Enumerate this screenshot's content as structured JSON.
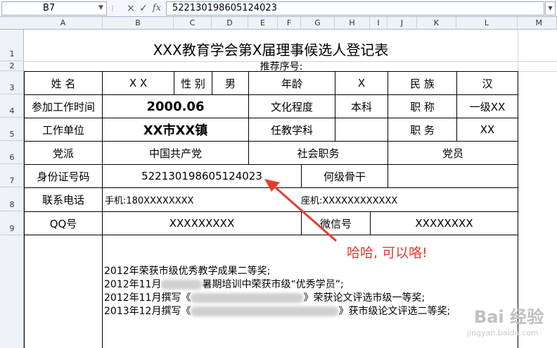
{
  "formula_bar": {
    "name_box": "B7",
    "cancel_icon": "×",
    "enter_icon": "✓",
    "fx_label": "fx",
    "formula_value": "522130198605124023"
  },
  "columns": [
    "A",
    "B",
    "C",
    "D",
    "E",
    "F",
    "G",
    "H",
    "I",
    "J",
    "K",
    "L",
    "M"
  ],
  "rows": [
    "1",
    "2",
    "3",
    "4",
    "5",
    "6",
    "7",
    "8",
    "9"
  ],
  "sheet": {
    "title": "XXX教育学会第X届理事候选人登记表",
    "recommend_no": "推荐序号:",
    "r3": {
      "name_label": "姓    名",
      "name_value": "X X",
      "gender_label": "性 别",
      "gender_value": "男",
      "age_label": "年龄",
      "age_value": "X",
      "ethnic_label": "民    族",
      "ethnic_value": "汉"
    },
    "r4": {
      "work_start_label": "参加工作时间",
      "work_start_value": "2000.06",
      "education_label": "文化程度",
      "education_value": "本科",
      "title_label": "职    称",
      "title_value": "一级XX"
    },
    "r5": {
      "employer_label": "工作单位",
      "employer_value": "XX市XX镇",
      "subject_label": "任教学科",
      "subject_value": "",
      "position_label": "职    务",
      "position_value": "XX"
    },
    "r6": {
      "party_label": "党派",
      "party_value": "中国共产党",
      "social_label": "社会职务",
      "social_value": "党员"
    },
    "r7": {
      "id_label": "身份证号码",
      "id_value": "522130198605124023",
      "backbone_label": "何级骨干",
      "backbone_value": ""
    },
    "r8": {
      "phone_label": "联系电话",
      "mobile": "手机:180XXXXXXXX",
      "landline": "座机:XXXXXXXXXXXX"
    },
    "r9": {
      "qq_label": "QQ号",
      "qq_value": "XXXXXXXXX",
      "wechat_label": "微信号",
      "wechat_value": "XXXXXXXX"
    },
    "awards": [
      {
        "before": "2012年荣获市级优秀教学成果二等奖;",
        "after": ""
      },
      {
        "before": "2012年11月",
        "after": "暑期培训中荣获市级“优秀学员”;"
      },
      {
        "before": "2012年11月撰写《",
        "after": "》荣获论文评选市级一等奖;"
      },
      {
        "before": "2013年12月撰写《",
        "after": "》获市级论文评选二等奖;"
      }
    ]
  },
  "annotation": {
    "text": "哈哈, 可以咯!",
    "color": "#e53b2f"
  },
  "watermark": {
    "logo": "Bai 经验",
    "url": "jingyan.baidu.com"
  }
}
